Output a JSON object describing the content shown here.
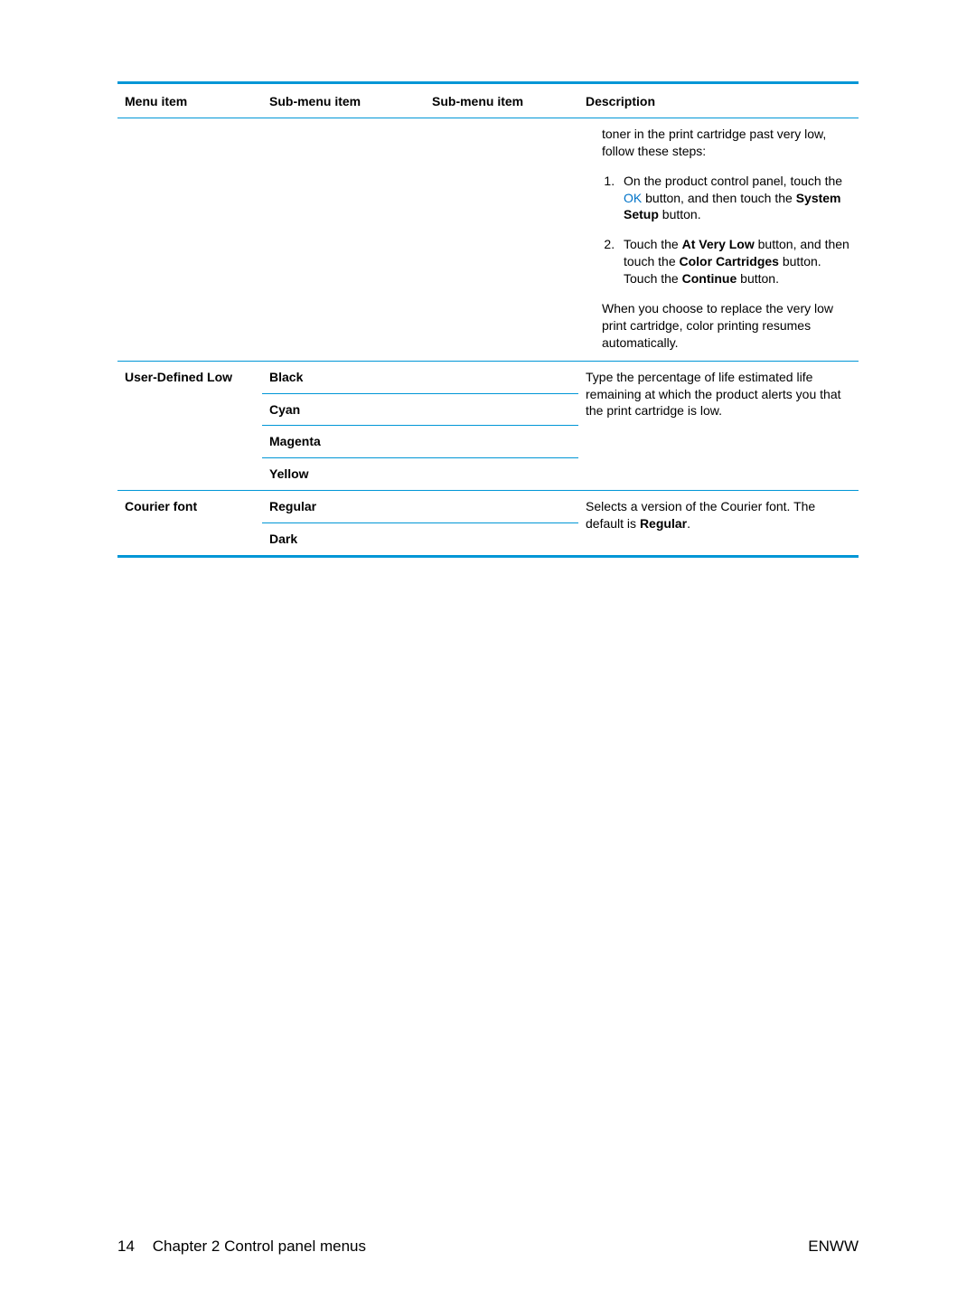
{
  "table": {
    "headers": {
      "menu": "Menu item",
      "sub1": "Sub-menu item",
      "sub2": "Sub-menu item",
      "desc": "Description"
    },
    "row1": {
      "desc_intro": "toner in the print cartridge past very low, follow these steps:",
      "step1_a": "On the product control panel, touch the ",
      "step1_ok": "OK",
      "step1_b": " button, and then touch the ",
      "step1_sys": "System Setup",
      "step1_c": " button.",
      "step2_a": "Touch the ",
      "step2_avl": "At Very Low",
      "step2_b": " button, and then touch the ",
      "step2_cc": "Color Cartridges",
      "step2_c": " button. Touch the ",
      "step2_cont": "Continue",
      "step2_d": " button.",
      "desc_outro": "When you choose to replace the very low print cartridge, color printing resumes automatically."
    },
    "row2": {
      "menu": "User-Defined Low",
      "sub_items": {
        "s0": "Black",
        "s1": "Cyan",
        "s2": "Magenta",
        "s3": "Yellow"
      },
      "desc": "Type the percentage of life estimated life remaining at which the product alerts you that the print cartridge is low."
    },
    "row3": {
      "menu": "Courier font",
      "sub_items": {
        "s0": "Regular",
        "s1": "Dark"
      },
      "desc_a": "Selects a version of the Courier font. The default is ",
      "desc_bold": "Regular",
      "desc_b": "."
    }
  },
  "footer": {
    "page_number": "14",
    "chapter": "Chapter 2   Control panel menus",
    "right": "ENWW"
  }
}
